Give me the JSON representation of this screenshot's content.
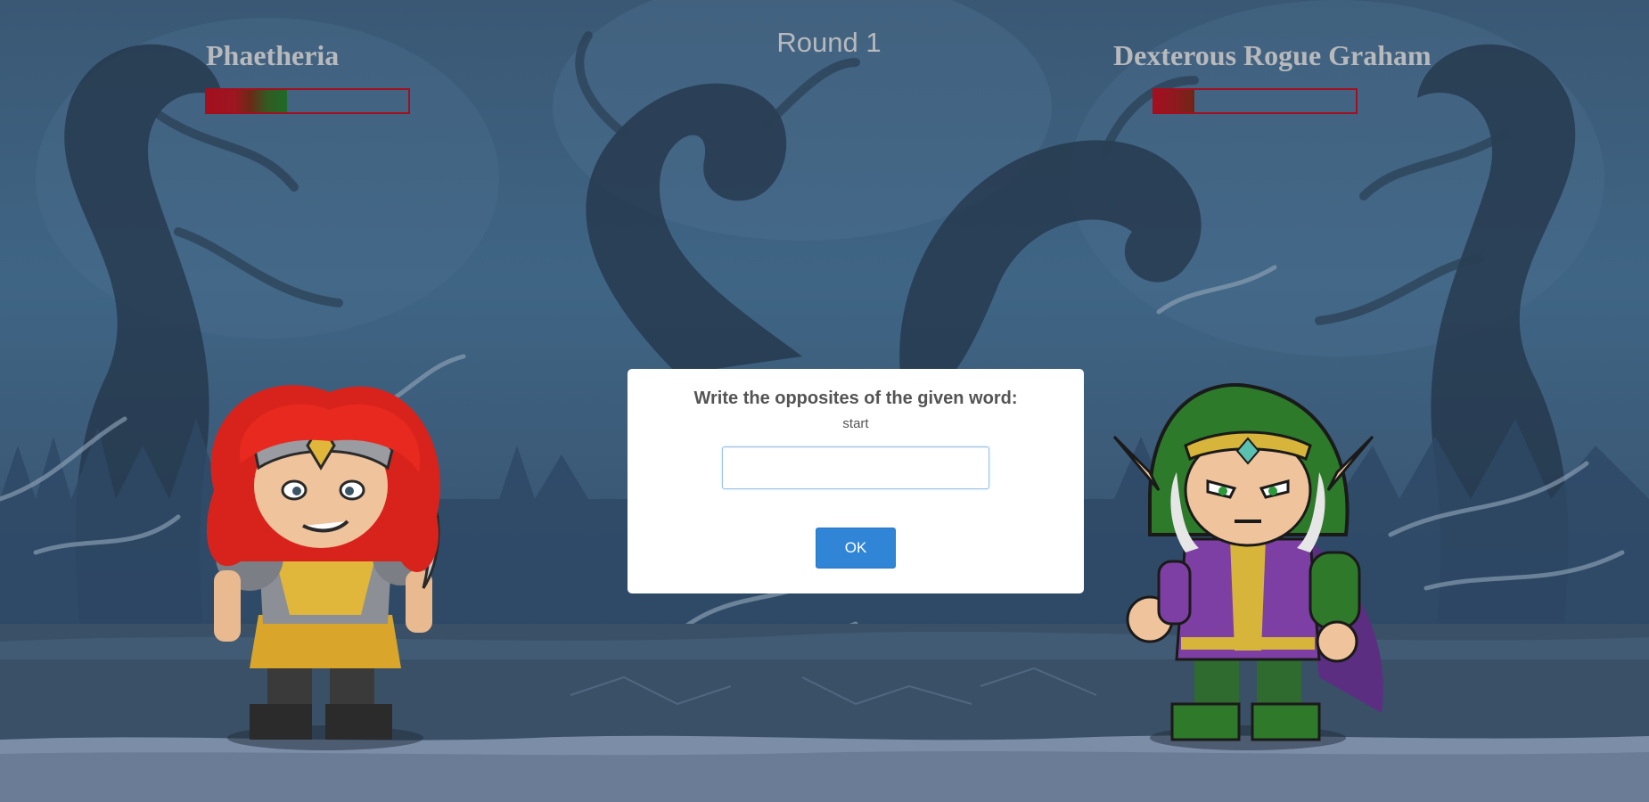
{
  "hud": {
    "round_label": "Round 1",
    "player": {
      "name": "Phaetheria",
      "health_fraction": 0.4
    },
    "enemy": {
      "name": "Dexterous Rogue Graham",
      "health_fraction": 0.2
    }
  },
  "dialog": {
    "title": "Write the opposites of the given word:",
    "word": "start",
    "input_value": "",
    "confirm_label": "OK"
  },
  "colors": {
    "hp_border": "#a30f1e",
    "hp_low": "#a30f1e",
    "hp_high": "#1d6b27",
    "confirm_button": "#3085d6",
    "hud_text": "#b7b9bc"
  },
  "characters": {
    "player_icon": "red-haired-warrior-icon",
    "enemy_icon": "green-hooded-elf-mage-icon"
  }
}
